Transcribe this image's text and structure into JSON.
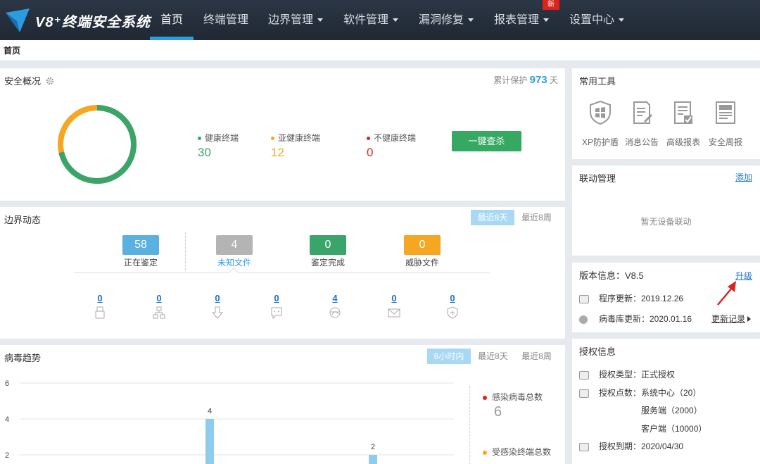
{
  "app": {
    "logo_text": "V8⁺终端安全系统"
  },
  "nav": {
    "items": [
      {
        "label": "首页",
        "dropdown": false,
        "active": true
      },
      {
        "label": "终端管理",
        "dropdown": false,
        "active": false
      },
      {
        "label": "边界管理",
        "dropdown": true,
        "active": false
      },
      {
        "label": "软件管理",
        "dropdown": true,
        "active": false
      },
      {
        "label": "漏洞修复",
        "dropdown": true,
        "active": false
      },
      {
        "label": "报表管理",
        "dropdown": true,
        "active": false
      },
      {
        "label": "设置中心",
        "dropdown": true,
        "active": false
      }
    ],
    "new_badge": "新"
  },
  "breadcrumb": "首页",
  "security": {
    "title": "安全概况",
    "protect_prefix": "累计保护",
    "protect_days": "973",
    "protect_suffix": "天",
    "healthy_label": "健康终端",
    "healthy_value": "30",
    "subhealthy_label": "亚健康终端",
    "subhealthy_value": "12",
    "unhealthy_label": "不健康终端",
    "unhealthy_value": "0",
    "scan_button": "一键查杀",
    "colors": {
      "healthy": "#3aa56a",
      "subhealthy": "#f5a623",
      "unhealthy": "#d9251d"
    }
  },
  "border": {
    "title": "边界动态",
    "tabs": [
      "最近8天",
      "最近8周"
    ],
    "boxes": [
      {
        "value": "58",
        "label": "正在鉴定",
        "color": "#5ab0de"
      },
      {
        "value": "4",
        "label": "未知文件",
        "color": "#b4b4b4"
      },
      {
        "value": "0",
        "label": "鉴定完成",
        "color": "#3aa56a"
      },
      {
        "value": "0",
        "label": "威胁文件",
        "color": "#f5a623"
      }
    ],
    "counts": [
      {
        "value": "0",
        "icon": "usb-icon"
      },
      {
        "value": "0",
        "icon": "network-icon"
      },
      {
        "value": "0",
        "icon": "download-icon"
      },
      {
        "value": "0",
        "icon": "chat-icon"
      },
      {
        "value": "4",
        "icon": "browser-icon"
      },
      {
        "value": "0",
        "icon": "mail-icon"
      },
      {
        "value": "0",
        "icon": "shield-plus-icon"
      }
    ]
  },
  "virus": {
    "title": "病毒趋势",
    "tabs": [
      "8小时内",
      "最近8天",
      "最近8周"
    ],
    "legend": [
      {
        "label": "感染病毒总数",
        "value": "6",
        "color": "#d9251d"
      },
      {
        "label": "受感染终端总数",
        "value": "",
        "color": "#f5a623"
      }
    ]
  },
  "chart_data": {
    "type": "bar",
    "title": "",
    "ylim": [
      0,
      6
    ],
    "y_ticks": [
      "2",
      "4",
      "6"
    ],
    "values": [
      {
        "value": 4,
        "label": "4"
      },
      {
        "value": 2,
        "label": "2"
      }
    ]
  },
  "tools": {
    "title": "常用工具",
    "items": [
      {
        "label": "XP防护盾",
        "icon": "xp-shield-icon"
      },
      {
        "label": "消息公告",
        "icon": "notice-icon"
      },
      {
        "label": "高级报表",
        "icon": "report-icon"
      },
      {
        "label": "安全周报",
        "icon": "weekly-news-icon"
      }
    ]
  },
  "linkage": {
    "title": "联动管理",
    "add": "添加",
    "empty": "暂无设备联动"
  },
  "version": {
    "title": "版本信息：V8.5",
    "upgrade": "升级",
    "program_update": "程序更新：2019.12.26",
    "virus_db_update": "病毒库更新：2020.01.16",
    "changelog": "更新记录"
  },
  "license": {
    "title": "授权信息",
    "type": "授权类型：正式授权",
    "points": "授权点数：系统中心（20）",
    "server": "服务端（2000）",
    "client": "客户端（10000）",
    "expiry": "授权到期：2020/04/30"
  }
}
